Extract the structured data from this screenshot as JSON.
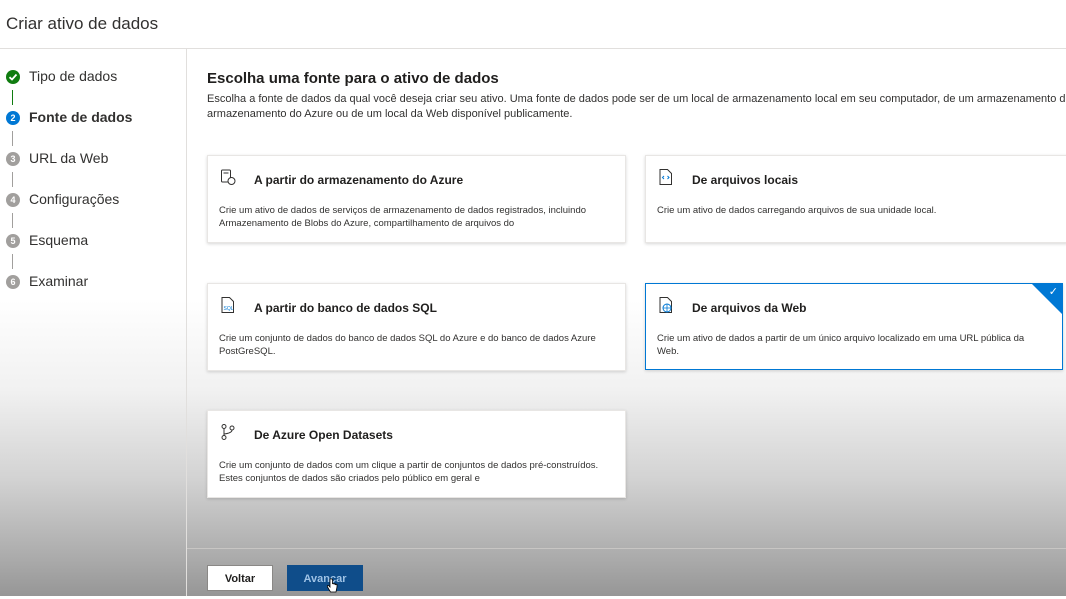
{
  "header": {
    "title": "Criar ativo de dados"
  },
  "steps": [
    {
      "label": "Tipo de dados",
      "status": "done"
    },
    {
      "label": "Fonte de dados",
      "status": "current",
      "number": "2"
    },
    {
      "label": "URL da Web",
      "status": "todo",
      "number": "3"
    },
    {
      "label": "Configurações",
      "status": "todo",
      "number": "4"
    },
    {
      "label": "Esquema",
      "status": "todo",
      "number": "5"
    },
    {
      "label": "Examinar",
      "status": "todo",
      "number": "6"
    }
  ],
  "main": {
    "heading": "Escolha uma fonte para o ativo de dados",
    "description": "Escolha a fonte de dados da qual você deseja criar seu ativo. Uma fonte de dados pode ser de um local de armazenamento local em seu computador, de um armazenamento do armazenamento do Azure ou de um local da Web disponível publicamente."
  },
  "cards": [
    {
      "icon": "azure-storage-icon",
      "title": "A partir do armazenamento do Azure",
      "description": "Crie um ativo de dados de serviços de armazenamento de dados registrados, incluindo Armazenamento de Blobs do Azure, compartilhamento de arquivos do",
      "selected": false
    },
    {
      "icon": "local-files-icon",
      "title": "De arquivos locais",
      "description": "Crie um ativo de dados carregando arquivos de sua unidade local.",
      "selected": false
    },
    {
      "icon": "sql-database-icon",
      "title": "A partir do banco de dados SQL",
      "description": "Crie um conjunto de dados do banco de dados SQL do Azure e do banco de dados Azure PostGreSQL.",
      "selected": false
    },
    {
      "icon": "web-file-icon",
      "title": "De arquivos da Web",
      "description": "Crie um ativo de dados a partir de um único arquivo localizado em uma URL pública da Web.",
      "selected": true
    },
    {
      "icon": "open-datasets-icon",
      "title": "De Azure Open Datasets",
      "description": "Crie um conjunto de dados com um clique a partir de conjuntos de dados pré-construídos. Estes conjuntos de dados são criados pelo público em geral e",
      "selected": false
    }
  ],
  "footer": {
    "back_label": "Voltar",
    "next_label": "Avançar"
  },
  "colors": {
    "accent": "#0078d4",
    "done": "#107c10",
    "pending": "#a19f9d",
    "primary_button": "#0f4d8a"
  }
}
